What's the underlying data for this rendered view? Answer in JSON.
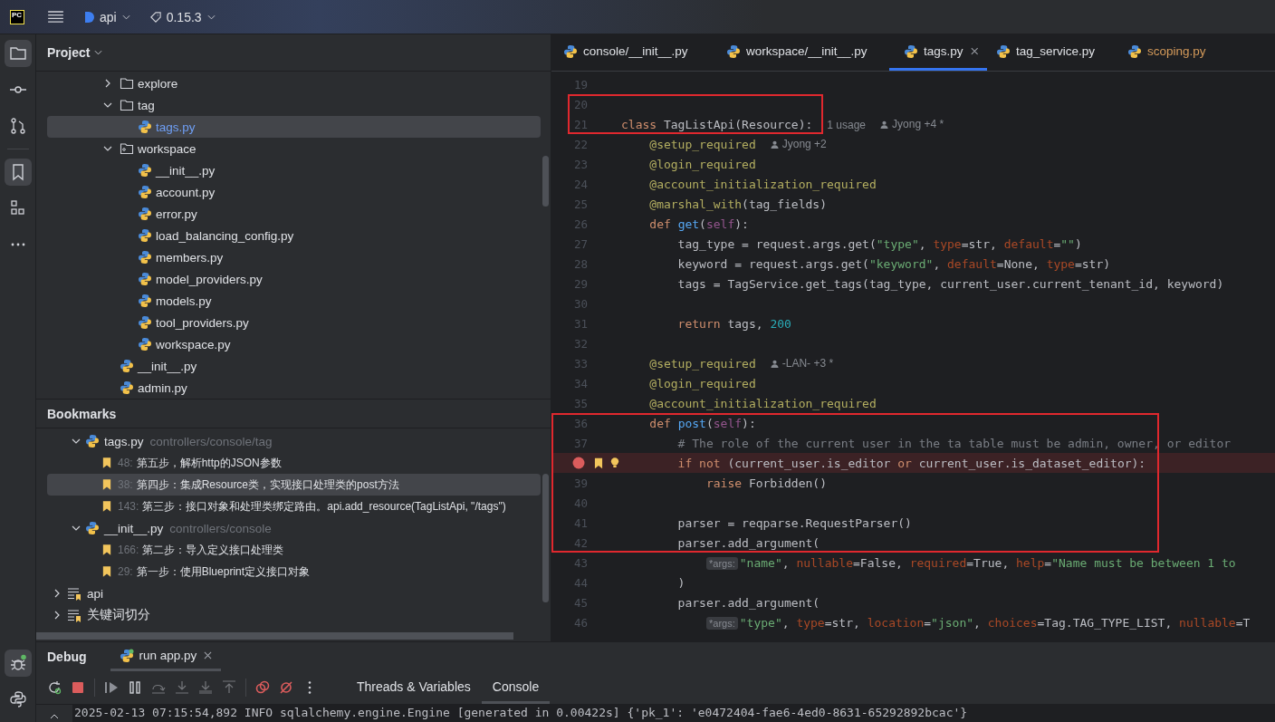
{
  "title_bar": {
    "logo": "PC",
    "project": "api",
    "branch": "0.15.3"
  },
  "project_panel": {
    "title": "Project",
    "tree": [
      {
        "name": "explore",
        "kind": "folder",
        "expanded": false,
        "selected": false
      },
      {
        "name": "tag",
        "kind": "folder",
        "expanded": true,
        "selected": false,
        "children": [
          {
            "name": "tags.py",
            "kind": "python",
            "selected": true
          }
        ]
      },
      {
        "name": "workspace",
        "kind": "module",
        "expanded": true,
        "selected": false,
        "children": [
          {
            "name": "__init__.py",
            "kind": "python",
            "selected": false
          },
          {
            "name": "account.py",
            "kind": "python",
            "selected": false
          },
          {
            "name": "error.py",
            "kind": "python",
            "selected": false
          },
          {
            "name": "load_balancing_config.py",
            "kind": "python",
            "selected": false
          },
          {
            "name": "members.py",
            "kind": "python",
            "selected": false
          },
          {
            "name": "model_providers.py",
            "kind": "python",
            "selected": false
          },
          {
            "name": "models.py",
            "kind": "python",
            "selected": false
          },
          {
            "name": "tool_providers.py",
            "kind": "python",
            "selected": false
          },
          {
            "name": "workspace.py",
            "kind": "python",
            "selected": false
          }
        ]
      },
      {
        "name": "__init__.py",
        "kind": "python",
        "selected": false
      },
      {
        "name": "admin.py",
        "kind": "python",
        "selected": false
      }
    ]
  },
  "bookmarks_panel": {
    "title": "Bookmarks",
    "groups": [
      {
        "file": "tags.py",
        "path": "controllers/console/tag",
        "expanded": true,
        "bookmarks": [
          {
            "line": "48:",
            "text": "第五步，解析http的JSON参数",
            "selected": false
          },
          {
            "line": "38:",
            "text": "第四步：集成Resource类，实现接口处理类的post方法",
            "selected": true
          },
          {
            "line": "143:",
            "text": "第三步：接口对象和处理类绑定路由。api.add_resource(TagListApi, \"/tags\")",
            "selected": false
          }
        ]
      },
      {
        "file": "__init__.py",
        "path": "controllers/console",
        "expanded": true,
        "bookmarks": [
          {
            "line": "166:",
            "text": "第二步：导入定义接口处理类",
            "selected": false
          },
          {
            "line": "29:",
            "text": "第一步：使用Blueprint定义接口对象",
            "selected": false
          }
        ]
      }
    ],
    "lists": [
      {
        "name": "api",
        "expanded": false
      },
      {
        "name": "关键词切分",
        "expanded": false
      }
    ]
  },
  "editor": {
    "tabs": [
      {
        "label": "console/__init__.py",
        "selected": false,
        "color": "#dfe1e5"
      },
      {
        "label": "workspace/__init__.py",
        "selected": false,
        "color": "#dfe1e5"
      },
      {
        "label": "tags.py",
        "selected": true,
        "color": "#dfe1e5"
      },
      {
        "label": "tag_service.py",
        "selected": false,
        "color": "#dfe1e5"
      },
      {
        "label": "scoping.py",
        "selected": false,
        "color": "#d49a5a"
      }
    ],
    "lines": [
      {
        "n": "19"
      },
      {
        "n": "20",
        "boxed": true,
        "kind": "narrow"
      },
      {
        "n": "21",
        "boxed": true,
        "kind": "narrow",
        "tokens": [
          {
            "kind": "kw",
            "text": "class "
          },
          {
            "kind": "plain",
            "text": "TagListApi(Resource):"
          },
          {
            "kind": "hint",
            "text": "1 usage"
          },
          {
            "kind": "author",
            "text": "Jyong +4 *"
          }
        ]
      },
      {
        "n": "22",
        "tokens": [
          {
            "kind": "deco",
            "text": "    @setup_required"
          },
          {
            "kind": "author",
            "text": "Jyong +2"
          }
        ]
      },
      {
        "n": "23",
        "tokens": [
          {
            "kind": "deco",
            "text": "    @login_required"
          }
        ]
      },
      {
        "n": "24",
        "tokens": [
          {
            "kind": "deco",
            "text": "    @account_initialization_required"
          }
        ]
      },
      {
        "n": "25",
        "tokens": [
          {
            "kind": "deco",
            "text": "    @marshal_with"
          },
          {
            "kind": "plain",
            "text": "(tag_fields)"
          }
        ]
      },
      {
        "n": "26",
        "tokens": [
          {
            "kind": "kw",
            "text": "    def "
          },
          {
            "kind": "fn",
            "text": "get"
          },
          {
            "kind": "plain",
            "text": "("
          },
          {
            "kind": "self",
            "text": "self"
          },
          {
            "kind": "plain",
            "text": "):"
          }
        ]
      },
      {
        "n": "27",
        "tokens": [
          {
            "kind": "plain",
            "text": "        tag_type = request.args.get("
          },
          {
            "kind": "str",
            "text": "\"type\""
          },
          {
            "kind": "plain",
            "text": ", "
          },
          {
            "kind": "param",
            "text": "type"
          },
          {
            "kind": "plain",
            "text": "=str, "
          },
          {
            "kind": "param",
            "text": "default"
          },
          {
            "kind": "plain",
            "text": "="
          },
          {
            "kind": "str",
            "text": "\"\""
          },
          {
            "kind": "plain",
            "text": ")"
          }
        ]
      },
      {
        "n": "28",
        "tokens": [
          {
            "kind": "plain",
            "text": "        keyword = request.args.get("
          },
          {
            "kind": "str",
            "text": "\"keyword\""
          },
          {
            "kind": "plain",
            "text": ", "
          },
          {
            "kind": "param",
            "text": "default"
          },
          {
            "kind": "plain",
            "text": "=None, "
          },
          {
            "kind": "param",
            "text": "type"
          },
          {
            "kind": "plain",
            "text": "=str)"
          }
        ]
      },
      {
        "n": "29",
        "tokens": [
          {
            "kind": "plain",
            "text": "        tags = TagService.get_tags(tag_type, current_user.current_tenant_id, keyword)"
          }
        ]
      },
      {
        "n": "30"
      },
      {
        "n": "31",
        "tokens": [
          {
            "kind": "kw",
            "text": "        return"
          },
          {
            "kind": "plain",
            "text": " tags, "
          },
          {
            "kind": "num",
            "text": "200"
          }
        ]
      },
      {
        "n": "32"
      },
      {
        "n": "33",
        "tokens": [
          {
            "kind": "deco",
            "text": "    @setup_required"
          },
          {
            "kind": "author",
            "text": "-LAN- +3 *"
          }
        ]
      },
      {
        "n": "34",
        "tokens": [
          {
            "kind": "deco",
            "text": "    @login_required"
          }
        ]
      },
      {
        "n": "35",
        "tokens": [
          {
            "kind": "deco",
            "text": "    @account_initialization_required"
          }
        ]
      },
      {
        "n": "36",
        "boxed": true,
        "kind": "wide",
        "tokens": [
          {
            "kind": "kw",
            "text": "    def "
          },
          {
            "kind": "fn",
            "text": "post"
          },
          {
            "kind": "plain",
            "text": "("
          },
          {
            "kind": "self",
            "text": "self"
          },
          {
            "kind": "plain",
            "text": "):"
          }
        ]
      },
      {
        "n": "37",
        "boxed": true,
        "kind": "wide",
        "tokens": [
          {
            "kind": "comment",
            "text": "        # The role of the current user in the ta table must be admin, owner, or editor"
          }
        ]
      },
      {
        "boxed": true,
        "kind": "wide",
        "breakpoint": true,
        "bookmarked": true,
        "intention": true,
        "tokens": [
          {
            "kind": "kw",
            "text": "        if not"
          },
          {
            "kind": "plain",
            "text": " (current_user.is_editor "
          },
          {
            "kind": "kw",
            "text": "or"
          },
          {
            "kind": "plain",
            "text": " current_user.is_dataset_editor):"
          }
        ]
      },
      {
        "n": "39",
        "boxed": true,
        "kind": "wide",
        "tokens": [
          {
            "kind": "kw",
            "text": "            raise"
          },
          {
            "kind": "plain",
            "text": " Forbidden()"
          }
        ]
      },
      {
        "n": "40",
        "boxed": true,
        "kind": "wide"
      },
      {
        "n": "41",
        "boxed": true,
        "kind": "wide",
        "tokens": [
          {
            "kind": "plain",
            "text": "        parser = reqparse.RequestParser()"
          }
        ]
      },
      {
        "n": "42",
        "boxed": true,
        "kind": "wide",
        "tokens": [
          {
            "kind": "plain",
            "text": "        parser.add_argument("
          }
        ]
      },
      {
        "n": "43",
        "tokens": [
          {
            "kind": "args",
            "text": "*args:"
          },
          {
            "kind": "str",
            "text": "\"name\""
          },
          {
            "kind": "plain",
            "text": ", "
          },
          {
            "kind": "param",
            "text": "nullable"
          },
          {
            "kind": "plain",
            "text": "=False, "
          },
          {
            "kind": "param",
            "text": "required"
          },
          {
            "kind": "plain",
            "text": "=True, "
          },
          {
            "kind": "param",
            "text": "help"
          },
          {
            "kind": "plain",
            "text": "="
          },
          {
            "kind": "str",
            "text": "\"Name must be between 1 to"
          }
        ]
      },
      {
        "n": "44",
        "tokens": [
          {
            "kind": "plain",
            "text": "        )"
          }
        ]
      },
      {
        "n": "45",
        "tokens": [
          {
            "kind": "plain",
            "text": "        parser.add_argument("
          }
        ]
      },
      {
        "n": "46",
        "tokens": [
          {
            "kind": "args",
            "text": "*args:"
          },
          {
            "kind": "str",
            "text": "\"type\""
          },
          {
            "kind": "plain",
            "text": ", "
          },
          {
            "kind": "param",
            "text": "type"
          },
          {
            "kind": "plain",
            "text": "=str, "
          },
          {
            "kind": "param",
            "text": "location"
          },
          {
            "kind": "plain",
            "text": "="
          },
          {
            "kind": "str",
            "text": "\"json\""
          },
          {
            "kind": "plain",
            "text": ", "
          },
          {
            "kind": "param",
            "text": "choices"
          },
          {
            "kind": "plain",
            "text": "=Tag.TAG_TYPE_LIST, "
          },
          {
            "kind": "param",
            "text": "nullable"
          },
          {
            "kind": "plain",
            "text": "=T"
          }
        ]
      }
    ]
  },
  "debug_panel": {
    "title": "Debug",
    "session": {
      "label": "run app.py",
      "selected": true
    },
    "toolbar": [
      {
        "kind": "rerun",
        "disabled": false
      },
      {
        "kind": "stop",
        "disabled": false
      },
      {
        "kind": "resume",
        "disabled": false
      },
      {
        "kind": "pause",
        "disabled": false
      },
      {
        "kind": "step_over",
        "disabled": true
      },
      {
        "kind": "step_into",
        "disabled": true
      },
      {
        "kind": "force_step_into",
        "disabled": true
      },
      {
        "kind": "step_out",
        "disabled": true
      },
      {
        "kind": "view_breakpoints",
        "disabled": false
      },
      {
        "kind": "mute_breakpoints",
        "disabled": false
      },
      {
        "kind": "more",
        "disabled": false
      }
    ],
    "view_tabs": [
      {
        "label": "Threads & Variables",
        "selected": false
      },
      {
        "label": "Console",
        "selected": true
      }
    ],
    "console_lines": [
      "2025-02-13 07:15:54,892 INFO sqlalchemy.engine.Engine [generated in 0.00422s] {'pk_1': 'e0472404-fae6-4ed0-8631-65292892bcac'}"
    ]
  }
}
